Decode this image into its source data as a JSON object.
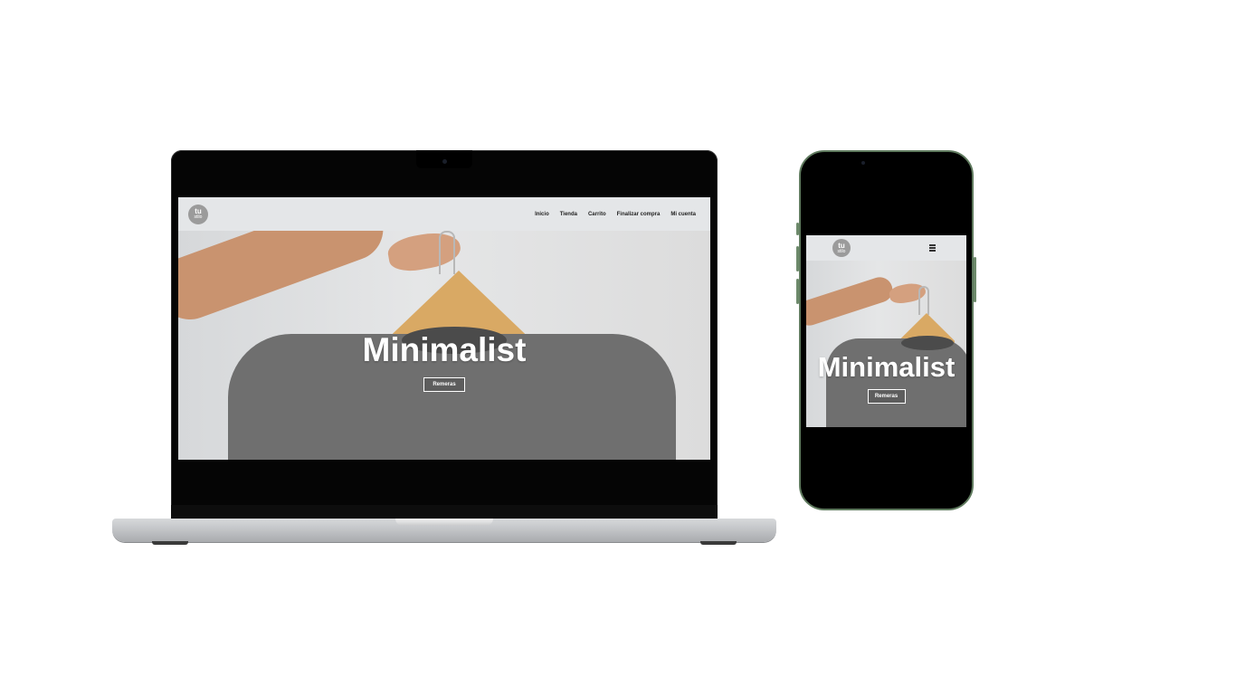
{
  "site": {
    "logo": {
      "line1": "tu",
      "line2": "stilo"
    },
    "nav": [
      "Inicio",
      "Tienda",
      "Carrito",
      "Finalizar compra",
      "Mi cuenta"
    ],
    "hero_title": "Minimalist",
    "hero_button": "Remeras"
  },
  "colors": {
    "header_bg": "#e4e6e8",
    "shirt": "#6f6f6f",
    "hanger": "#d9a964",
    "phone_frame": "#5f7a5e"
  }
}
